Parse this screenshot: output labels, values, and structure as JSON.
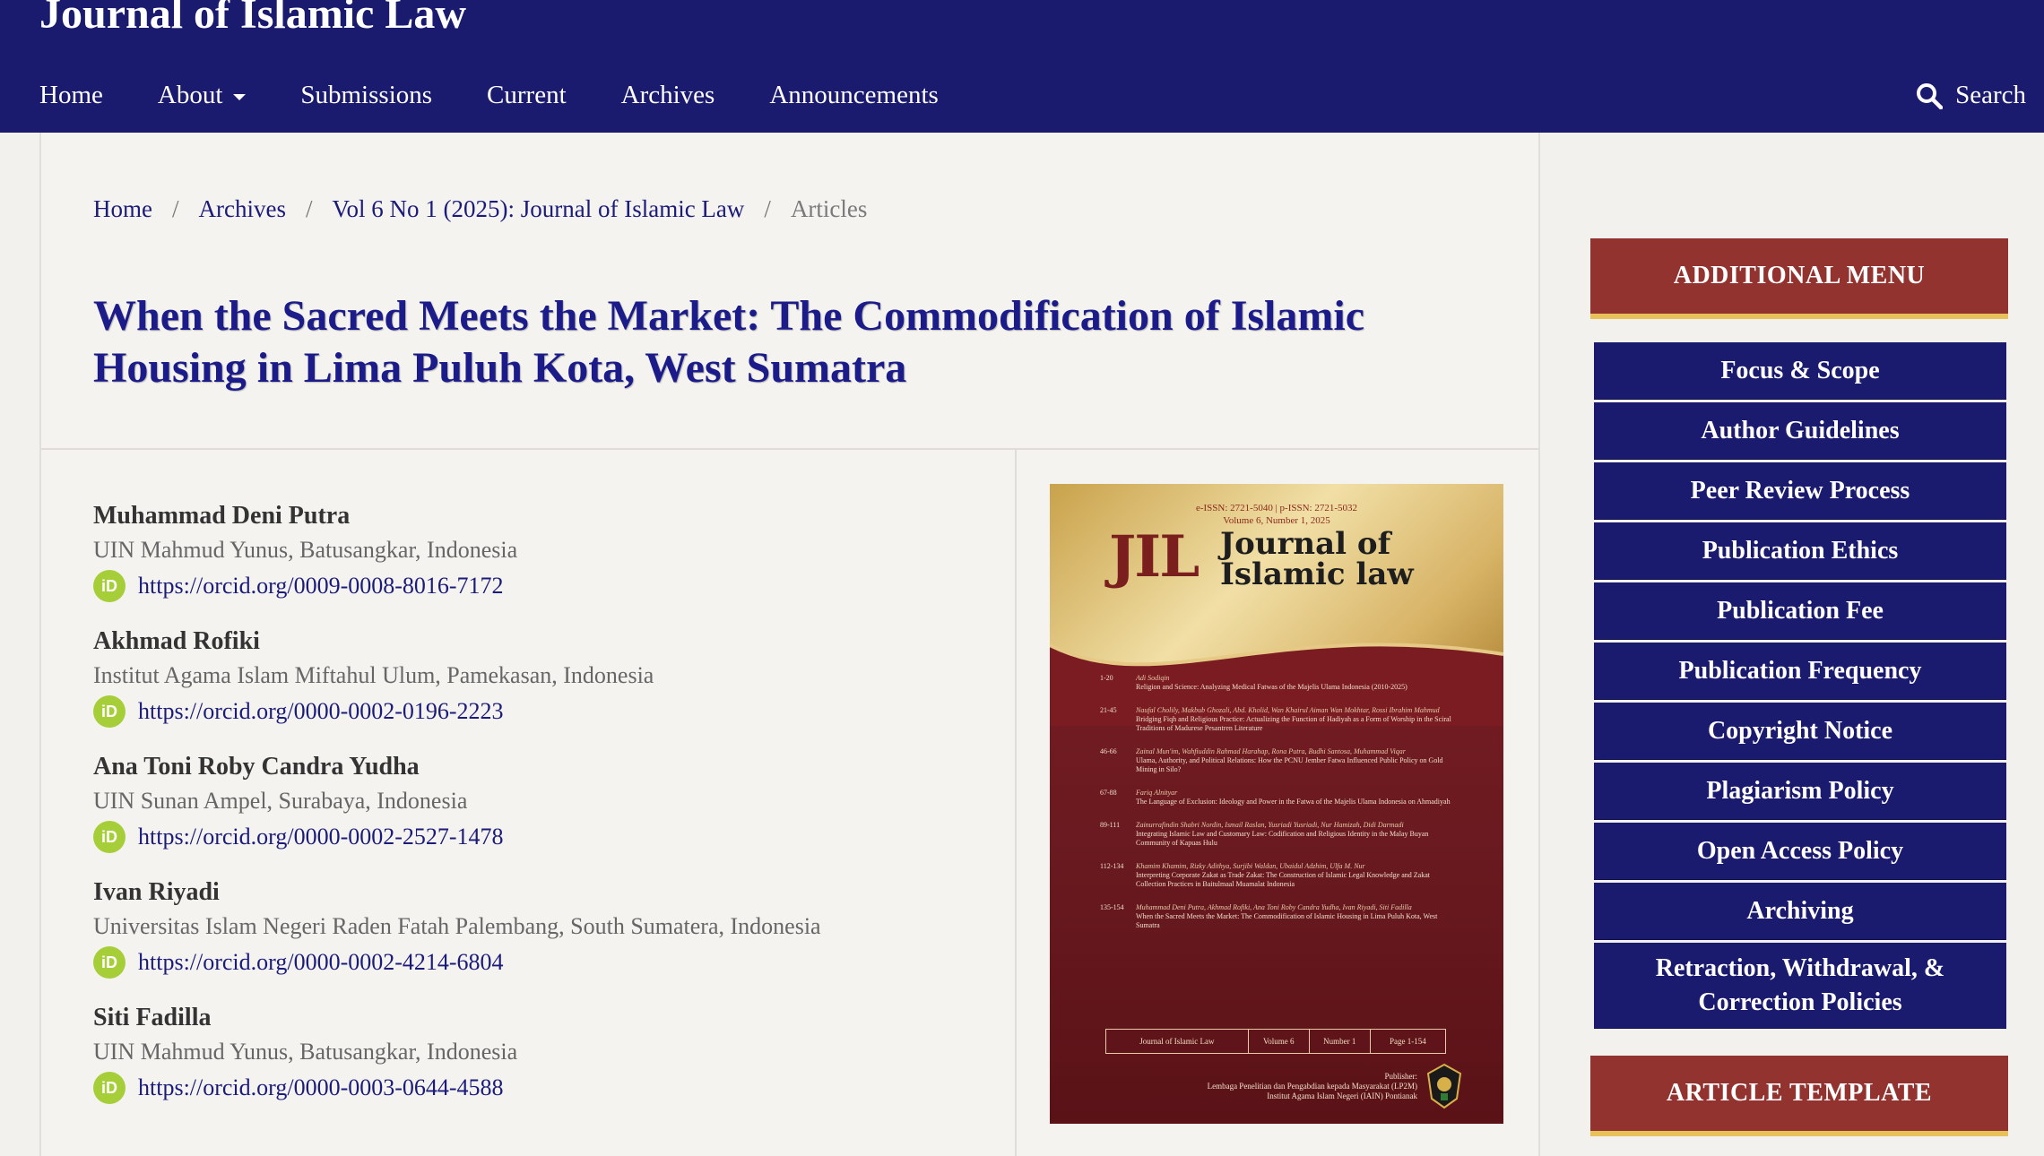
{
  "header": {
    "site_title": "Journal of Islamic Law",
    "nav": [
      "Home",
      "About",
      "Submissions",
      "Current",
      "Archives",
      "Announcements"
    ],
    "search_label": "Search"
  },
  "breadcrumb": {
    "items": [
      "Home",
      "Archives",
      "Vol 6 No 1 (2025): Journal of Islamic Law"
    ],
    "current": "Articles"
  },
  "article": {
    "title": "When the Sacred Meets the Market: The Commodification of Islamic Housing in Lima Puluh Kota, West Sumatra",
    "authors": [
      {
        "name": "Muhammad Deni Putra",
        "affiliation": "UIN Mahmud Yunus, Batusangkar, Indonesia",
        "orcid": "https://orcid.org/0009-0008-8016-7172"
      },
      {
        "name": "Akhmad Rofiki",
        "affiliation": "Institut Agama Islam Miftahul Ulum, Pamekasan, Indonesia",
        "orcid": "https://orcid.org/0000-0002-0196-2223"
      },
      {
        "name": "Ana Toni Roby Candra Yudha",
        "affiliation": "UIN Sunan Ampel, Surabaya, Indonesia",
        "orcid": "https://orcid.org/0000-0002-2527-1478"
      },
      {
        "name": "Ivan Riyadi",
        "affiliation": "Universitas Islam Negeri Raden Fatah Palembang, South Sumatera, Indonesia",
        "orcid": "https://orcid.org/0000-0002-4214-6804"
      },
      {
        "name": "Siti Fadilla",
        "affiliation": "UIN Mahmud Yunus, Batusangkar, Indonesia",
        "orcid": "https://orcid.org/0000-0003-0644-4588"
      }
    ],
    "orcid_icon_label": "iD"
  },
  "cover": {
    "issn": "e-ISSN: 2721-5040 | p-ISSN: 2721-5032",
    "volume_line": "Volume 6, Number 1, 2025",
    "logo": "JIL",
    "journal_name_1": "Journal of",
    "journal_name_2": "Islamic law",
    "toc": [
      {
        "pages": "1-20",
        "authors": "Adi Sodiqin",
        "title": "Religion and Science: Analyzing Medical Fatwas of the Majelis Ulama Indonesia (2010-2025)"
      },
      {
        "pages": "21-45",
        "authors": "Naufal Cholily, Makbub Ghozali, Abd. Kholid, Wan Khairul Aiman Wan Mokhtar, Rossi Ibrahim Mahmud",
        "title": "Bridging Fiqh and Religious Practice: Actualizing the Function of Hadiyah as a Form of Worship in the Sciral Traditions of Madurese Pesantren Literature"
      },
      {
        "pages": "46-66",
        "authors": "Zainal Mun'im, Wahfiuddin Rahmad Harahap, Rona Putra, Budhi Santosa, Muhammad Viqar",
        "title": "Ulama, Authority, and Political Relations: How the PCNU Jember Fatwa Influenced Public Policy on Gold Mining in Silo?"
      },
      {
        "pages": "67-88",
        "authors": "Fariq Alnityar",
        "title": "The Language of Exclusion: Ideology and Power in the Fatwa of the Majelis Ulama Indonesia on Ahmadiyah"
      },
      {
        "pages": "89-111",
        "authors": "Zainurrafindin Shabri Nordin, Ismail Raslan, Yusriadi Yusriadi, Nur Hamizah, Didi Darmadi",
        "title": "Integrating Islamic Law and Customary Law: Codification and Religious Identity in the Malay Buyan Community of Kapuas Hulu"
      },
      {
        "pages": "112-134",
        "authors": "Khamim Khamim, Rizky Adithya, Surjibi Waldan, Ubaidul Adzhim, Ulfa M. Nur",
        "title": "Interpreting Corporate Zakat as Trade Zakat: The Construction of Islamic Legal Knowledge and Zakat Collection Practices in Baitulmaal Muamalat Indonesia"
      },
      {
        "pages": "135-154",
        "authors": "Muhammad Deni Putra, Akhmad Rofiki, Ana Toni Roby Candra Yudha, Ivan Riyadi, Siti Fadilla",
        "title": "When the Sacred Meets the Market: The Commodification of Islamic Housing in Lima Puluh Kota, West Sumatra"
      }
    ],
    "boxes": [
      "Journal of Islamic Law",
      "Volume 6",
      "Number 1",
      "Page 1-154"
    ],
    "publisher_label": "Publisher:",
    "publisher_line1": "Lembaga Penelitian dan Pengabdian kepada Masyarakat (LP2M)",
    "publisher_line2": "Institut Agama Islam Negeri (IAIN) Pontianak"
  },
  "sidebar": {
    "additional_menu_title": "ADDITIONAL MENU",
    "menu_items": [
      "Focus & Scope",
      "Author Guidelines",
      "Peer Review Process",
      "Publication Ethics",
      "Publication Fee",
      "Publication Frequency",
      "Copyright Notice",
      "Plagiarism Policy",
      "Open Access Policy",
      "Archiving",
      "Retraction, Withdrawal, & Correction Policies"
    ],
    "article_template_title": "ARTICLE TEMPLATE"
  },
  "colors": {
    "header_bg": "#1a1a6e",
    "title_color": "#1b1b8a",
    "sidebar_head_bg": "#93332f",
    "sidebar_head_border": "#e8c15a",
    "orcid_green": "#a6ce39"
  },
  "icons": [
    "search-icon",
    "caret-down-icon",
    "orcid-icon"
  ]
}
